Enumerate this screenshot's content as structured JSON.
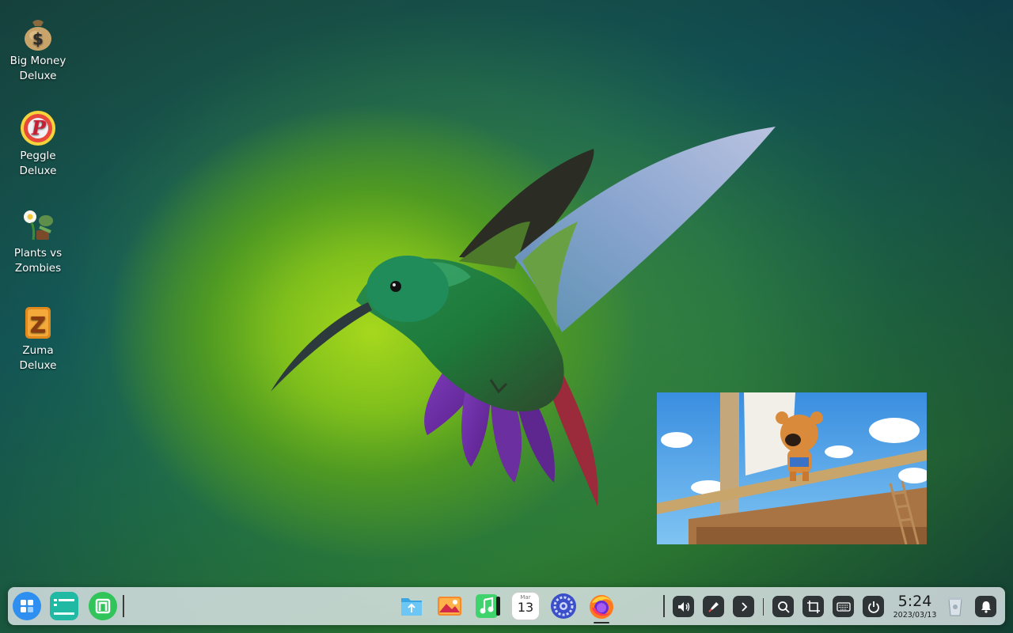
{
  "desktop": {
    "icons": [
      {
        "label": "Big Money Deluxe",
        "icon": "money-bag-icon"
      },
      {
        "label": "Peggle Deluxe",
        "icon": "peggle-icon"
      },
      {
        "label": "Plants vs Zombies",
        "icon": "plants-vs-zombies-icon"
      },
      {
        "label": "Zuma Deluxe",
        "icon": "zuma-icon"
      }
    ]
  },
  "video_preview": {
    "content": "cartoon-bear-on-ship"
  },
  "taskbar": {
    "left": [
      "launcher-icon",
      "multitask-view-icon",
      "app-store-icon"
    ],
    "center": [
      "file-manager-icon",
      "image-viewer-icon",
      "music-icon",
      "calendar-icon",
      "control-center-icon",
      "firefox-icon"
    ],
    "calendar_day": "13",
    "calendar_month": "Mar",
    "tray": [
      "volume-icon",
      "pen-icon",
      "chevron-right-icon",
      "search-icon",
      "screenshot-icon",
      "keyboard-icon",
      "power-icon"
    ],
    "clock": {
      "time": "5:24",
      "date": "2023/03/13"
    },
    "right": [
      "trash-icon",
      "notification-bell-icon"
    ]
  },
  "colors": {
    "accent_launcher": "#2f8ff0",
    "dock_bg": "#e1e8ec",
    "tray_bg": "#2f3437"
  }
}
